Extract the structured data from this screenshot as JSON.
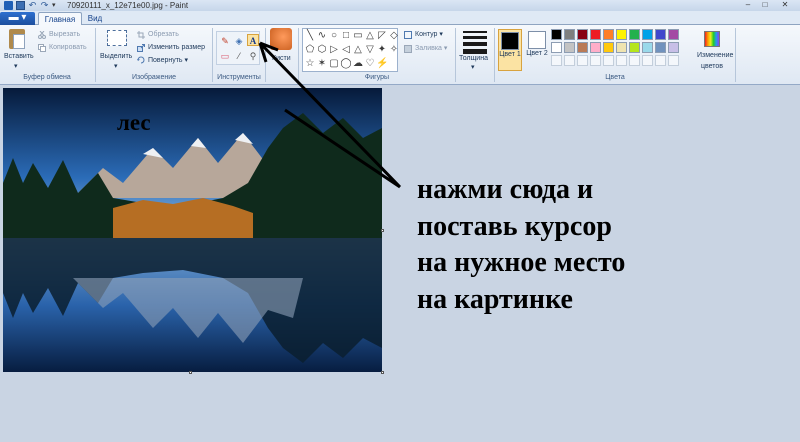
{
  "window": {
    "title": "70920111_x_12e71e00.jpg - Paint",
    "controls": {
      "minimize": "–",
      "maximize": "□",
      "close": "✕"
    }
  },
  "quick_access": {
    "menu_arrow": "▾",
    "undo": "↶",
    "redo": "↷"
  },
  "tabs": {
    "file_label": "▬ ▾",
    "items": [
      {
        "label": "Главная",
        "active": true
      },
      {
        "label": "Вид",
        "active": false
      }
    ]
  },
  "ribbon": {
    "clipboard": {
      "paste_label": "Вставить",
      "paste_arrow": "▾",
      "cut_label": "Вырезать",
      "copy_label": "Копировать",
      "group_label": "Буфер обмена"
    },
    "image": {
      "select_label": "Выделить",
      "select_arrow": "▾",
      "crop_label": "Обрезать",
      "resize_label": "Изменить размер",
      "rotate_label": "Повернуть ▾",
      "group_label": "Изображение"
    },
    "tools": {
      "pencil": "✎",
      "fill": "◈",
      "text": "A",
      "eraser": "▭",
      "picker": "⁄",
      "magnifier": "⚲",
      "group_label": "Инструменты"
    },
    "brushes": {
      "label": "Кисти"
    },
    "shapes": {
      "icons": [
        "╲",
        "∿",
        "○",
        "□",
        "▭",
        "△",
        "◸",
        "◇",
        "⬠",
        "⬡",
        "▷",
        "◁",
        "△",
        "▽",
        "✦",
        "✧",
        "☆",
        "✶",
        "▢",
        "◯",
        "☁",
        "♡",
        "⚡",
        ""
      ],
      "outline_label": "Контур ▾",
      "fill_label": "Заливка ▾",
      "group_label": "Фигуры"
    },
    "size": {
      "label": "Толщина",
      "arrow": "▾"
    },
    "colors": {
      "color1_label": "Цвет 1",
      "color1": "#000000",
      "color2_label": "Цвет 2",
      "color2": "#ffffff",
      "palette": [
        "#000000",
        "#7f7f7f",
        "#880015",
        "#ed1c24",
        "#ff7f27",
        "#fff200",
        "#22b14c",
        "#00a2e8",
        "#3f48cc",
        "#a349a4",
        "#ffffff",
        "#c3c3c3",
        "#b97a57",
        "#ffaec9",
        "#ffc90e",
        "#efe4b0",
        "#b5e61d",
        "#99d9ea",
        "#7092be",
        "#c8bfe7"
      ],
      "edit_label": "Изменение цветов",
      "group_label": "Цвета"
    }
  },
  "canvas": {
    "picture_caption": "лес",
    "annotation_lines": [
      "нажми сюда и",
      "поставь курсор",
      "на нужное место",
      "на картинке"
    ]
  }
}
